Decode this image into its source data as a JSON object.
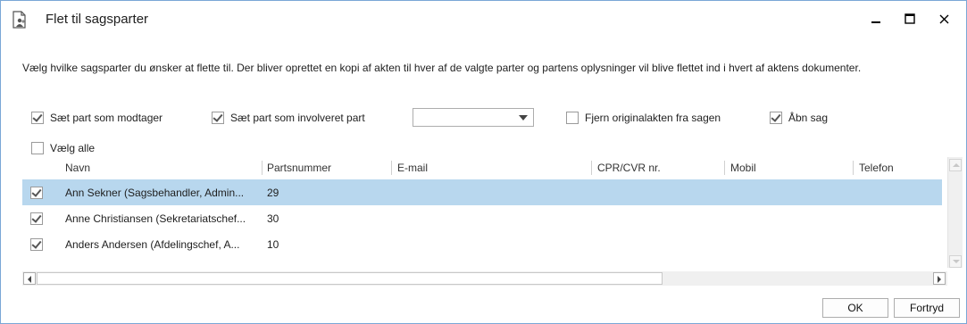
{
  "window": {
    "title": "Flet til sagsparter",
    "icon": "document-people-icon",
    "controls": {
      "minimize": "▁",
      "maximize": "□",
      "close": "✕"
    }
  },
  "description": "Vælg hvilke sagsparter du ønsker at flette til. Der bliver oprettet en kopi af akten til hver af de valgte parter og partens oplysninger vil blive flettet ind i hvert af aktens dokumenter.",
  "options": {
    "set_recipient": {
      "label": "Sæt part som modtager",
      "checked": true
    },
    "set_involved": {
      "label": "Sæt part som involveret part",
      "checked": true
    },
    "role_dropdown": {
      "value": ""
    },
    "remove_original": {
      "label": "Fjern originalakten fra sagen",
      "checked": false
    },
    "open_case": {
      "label": "Åbn sag",
      "checked": true
    },
    "select_all": {
      "label": "Vælg alle",
      "checked": false
    }
  },
  "table": {
    "columns": [
      "Navn",
      "Partsnummer",
      "E-mail",
      "CPR/CVR nr.",
      "Mobil",
      "Telefon"
    ],
    "rows": [
      {
        "checked": true,
        "selected": true,
        "navn": "Ann Sekner (Sagsbehandler, Admin...",
        "partsnummer": "29",
        "email": "",
        "cpr": "",
        "mobil": "",
        "telefon": ""
      },
      {
        "checked": true,
        "selected": false,
        "navn": "Anne Christiansen (Sekretariatschef...",
        "partsnummer": "30",
        "email": "",
        "cpr": "",
        "mobil": "",
        "telefon": ""
      },
      {
        "checked": true,
        "selected": false,
        "navn": "Anders Andersen (Afdelingschef, A...",
        "partsnummer": "10",
        "email": "",
        "cpr": "",
        "mobil": "",
        "telefon": ""
      }
    ]
  },
  "buttons": {
    "ok": "OK",
    "cancel": "Fortryd"
  },
  "colors": {
    "selection": "#b8d7ee",
    "border": "#7aa7d6"
  }
}
